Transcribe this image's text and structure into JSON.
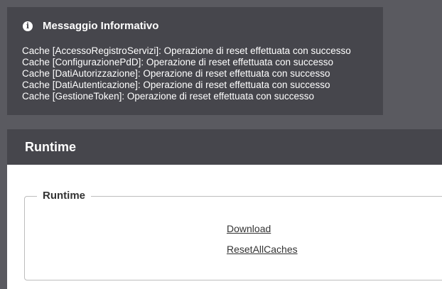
{
  "message": {
    "title": "Messaggio Informativo",
    "icon": "info-icon",
    "lines": [
      "Cache [AccessoRegistroServizi]: Operazione di reset effettuata con successo",
      "Cache [ConfigurazionePdD]: Operazione di reset effettuata con successo",
      "Cache [DatiAutorizzazione]: Operazione di reset effettuata con successo",
      "Cache [DatiAutenticazione]: Operazione di reset effettuata con successo",
      "Cache [GestioneToken]: Operazione di reset effettuata con successo"
    ]
  },
  "panel": {
    "title": "Runtime",
    "fieldset_legend": "Runtime",
    "links": [
      "Download",
      "ResetAllCaches"
    ]
  },
  "colors": {
    "page_background": "#5a5a60",
    "box_background": "#46464c",
    "panel_background": "#ffffff"
  }
}
